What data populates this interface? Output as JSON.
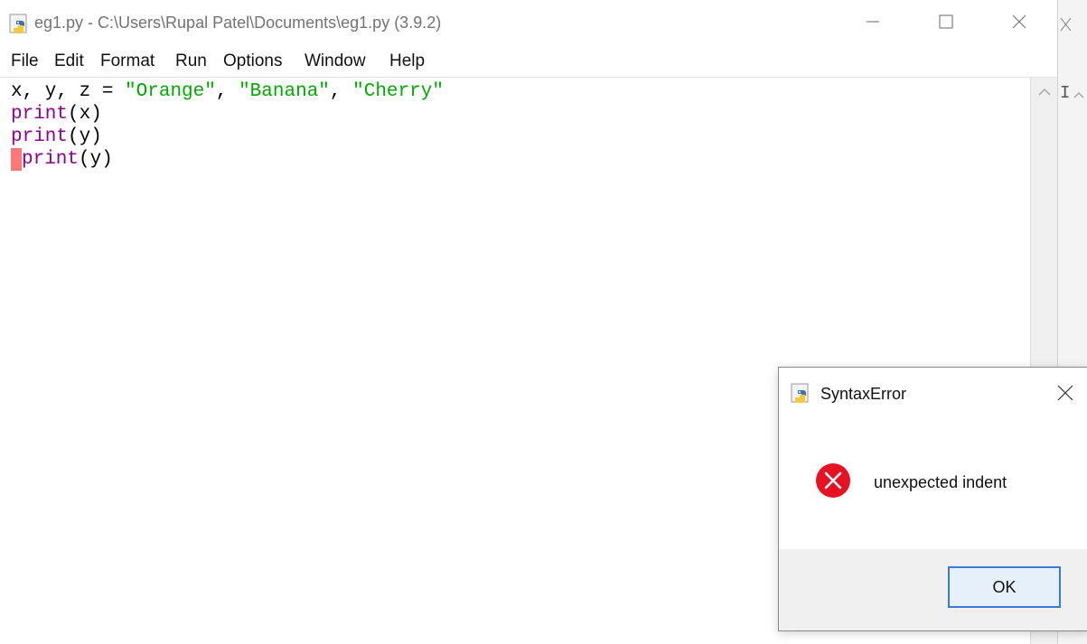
{
  "window": {
    "title": "eg1.py - C:\\Users\\Rupal Patel\\Documents\\eg1.py (3.9.2)"
  },
  "menu": {
    "items": [
      "File",
      "Edit",
      "Format",
      "Run",
      "Options",
      "Window",
      "Help"
    ]
  },
  "editor": {
    "line1": {
      "prefix": "x, y, z = ",
      "s1": "\"Orange\"",
      "sep1": ", ",
      "s2": "\"Banana\"",
      "sep2": ", ",
      "s3": "\"Cherry\""
    },
    "line2": {
      "kw": "print",
      "rest": "(x)"
    },
    "line3": {
      "kw": "print",
      "rest": "(y)"
    },
    "line4": {
      "kw": "print",
      "rest": "(y)"
    }
  },
  "background_window": {
    "letter": "I"
  },
  "dialog": {
    "title": "SyntaxError",
    "message": "unexpected indent",
    "ok_label": "OK"
  },
  "colors": {
    "keyword": "#900090",
    "string": "#00aa00",
    "error_highlight": "#ff7777",
    "error_icon": "#e81123",
    "button_border": "#3c7ad8"
  },
  "icons": {
    "app": "python-idle-icon",
    "minimize": "minimize-icon",
    "maximize": "maximize-icon",
    "close": "close-icon",
    "error": "error-circle-x-icon"
  }
}
